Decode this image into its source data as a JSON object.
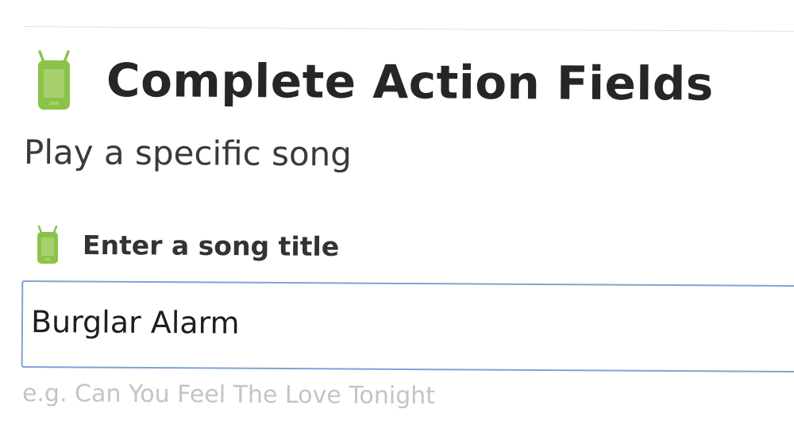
{
  "header": {
    "title": "Complete Action Fields",
    "icon": "android-phone-icon"
  },
  "action": {
    "subtitle": "Play a specific song"
  },
  "field": {
    "label": "Enter a song title",
    "icon": "android-phone-icon",
    "value": "Burglar Alarm",
    "helper": "e.g. Can You Feel The Love Tonight"
  },
  "colors": {
    "android_green": "#8bc34a",
    "input_border": "#7ea3d6",
    "title_text": "#262626",
    "helper_text": "#c4c4c4"
  }
}
